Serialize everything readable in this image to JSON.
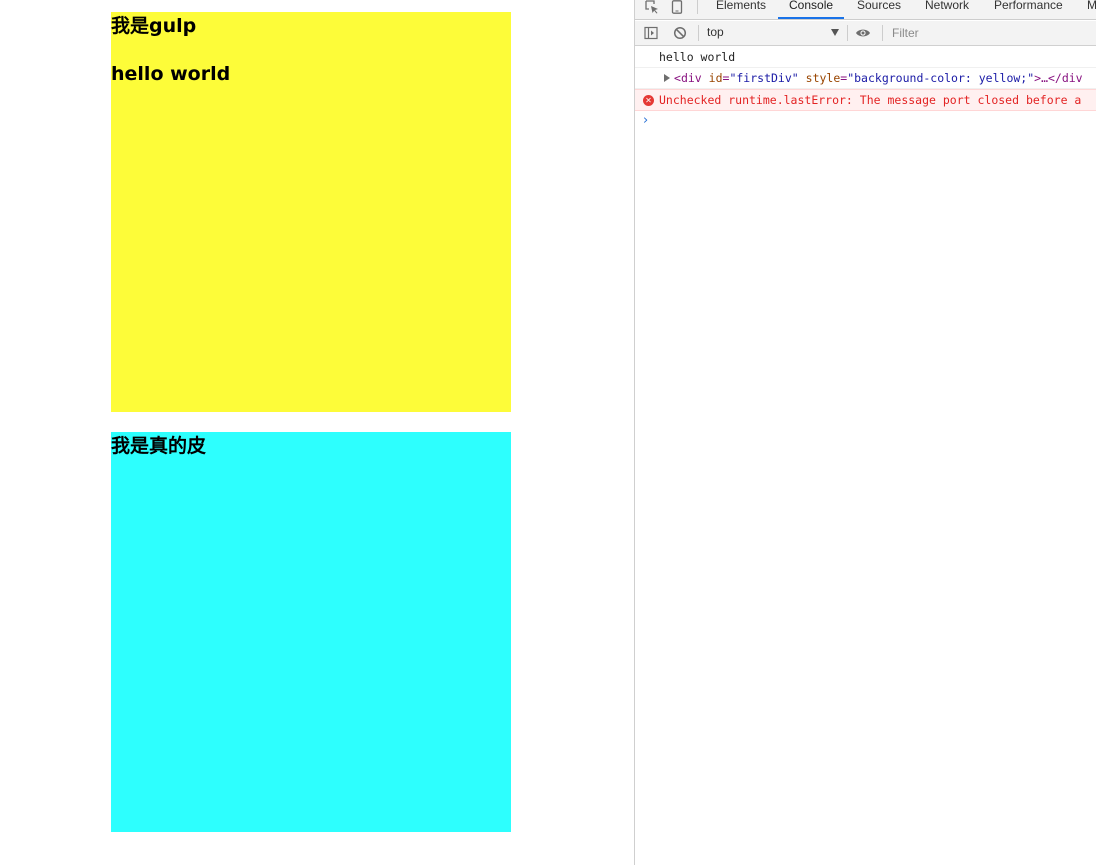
{
  "page": {
    "yellow_box": {
      "title": "我是gulp",
      "text": "hello world",
      "color": "#fdfc39"
    },
    "cyan_box": {
      "title": "我是真的皮",
      "color": "#2dfffe"
    }
  },
  "devtools": {
    "tabs": [
      {
        "label": "Elements"
      },
      {
        "label": "Console"
      },
      {
        "label": "Sources"
      },
      {
        "label": "Network"
      },
      {
        "label": "Performance"
      },
      {
        "label": "M"
      }
    ],
    "toolbar": {
      "context": "top",
      "filter_placeholder": "Filter"
    },
    "messages": {
      "log": "hello world",
      "element": {
        "open": "<",
        "tag": "div",
        "attr1": "id",
        "val1": "\"firstDiv\"",
        "attr2": "style",
        "val2": "\"background-color: yellow;\"",
        "rest": ">…</div"
      },
      "error": "Unchecked runtime.lastError: The message port closed before a"
    },
    "accent_color": "#1a73e8",
    "error_color": "#e32323"
  }
}
